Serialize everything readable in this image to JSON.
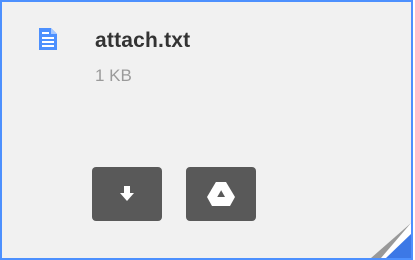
{
  "attachment": {
    "file_name": "attach.txt",
    "file_size": "1 KB",
    "file_icon": "document-icon",
    "accent_color": "#4d90fe"
  },
  "actions": {
    "download_icon": "download-icon",
    "drive_icon": "google-drive-icon"
  }
}
